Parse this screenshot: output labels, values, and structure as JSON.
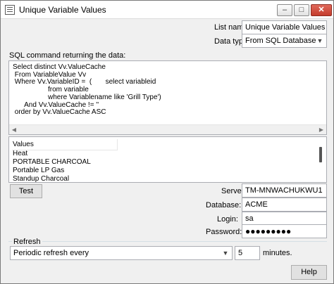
{
  "window": {
    "title": "Unique Variable Values",
    "minimize": "–",
    "maximize": "□",
    "close": "✕"
  },
  "form": {
    "list_name_label": "List name:",
    "list_name_value": "Unique Variable Values",
    "data_type_label": "Data type:",
    "data_type_value": "From SQL Database",
    "sql_label": "SQL command returning the data:",
    "sql_text": "Select distinct Vv.ValueCache\n From VariableValue Vv\n Where Vv.VariableID =  (       select variableid\n                  from variable\n                  where Variablename like 'Grill Type')\n      And Vv.ValueCache != ''\n order by Vv.ValueCache ASC"
  },
  "values_list": {
    "header": "Values",
    "items": [
      "Heat",
      "PORTABLE CHARCOAL",
      "Portable LP Gas",
      "Standup Charcoal"
    ]
  },
  "connection": {
    "test_button": "Test",
    "server_label": "Server:",
    "server_value": "TM-MNWACHUKWU1",
    "database_label": "Database:",
    "database_value": "ACME",
    "login_label": "Login:",
    "login_value": "sa",
    "password_label": "Password:",
    "password_value": "●●●●●●●●●"
  },
  "refresh": {
    "group_title": "Refresh",
    "mode_value": "Periodic refresh every",
    "interval_value": "5",
    "units": "minutes."
  },
  "footer": {
    "help_button": "Help"
  },
  "icons": {
    "app": "list-icon",
    "combo": "chevron-down-icon",
    "scroll_left": "arrow-left-icon",
    "scroll_right": "arrow-right-icon"
  }
}
